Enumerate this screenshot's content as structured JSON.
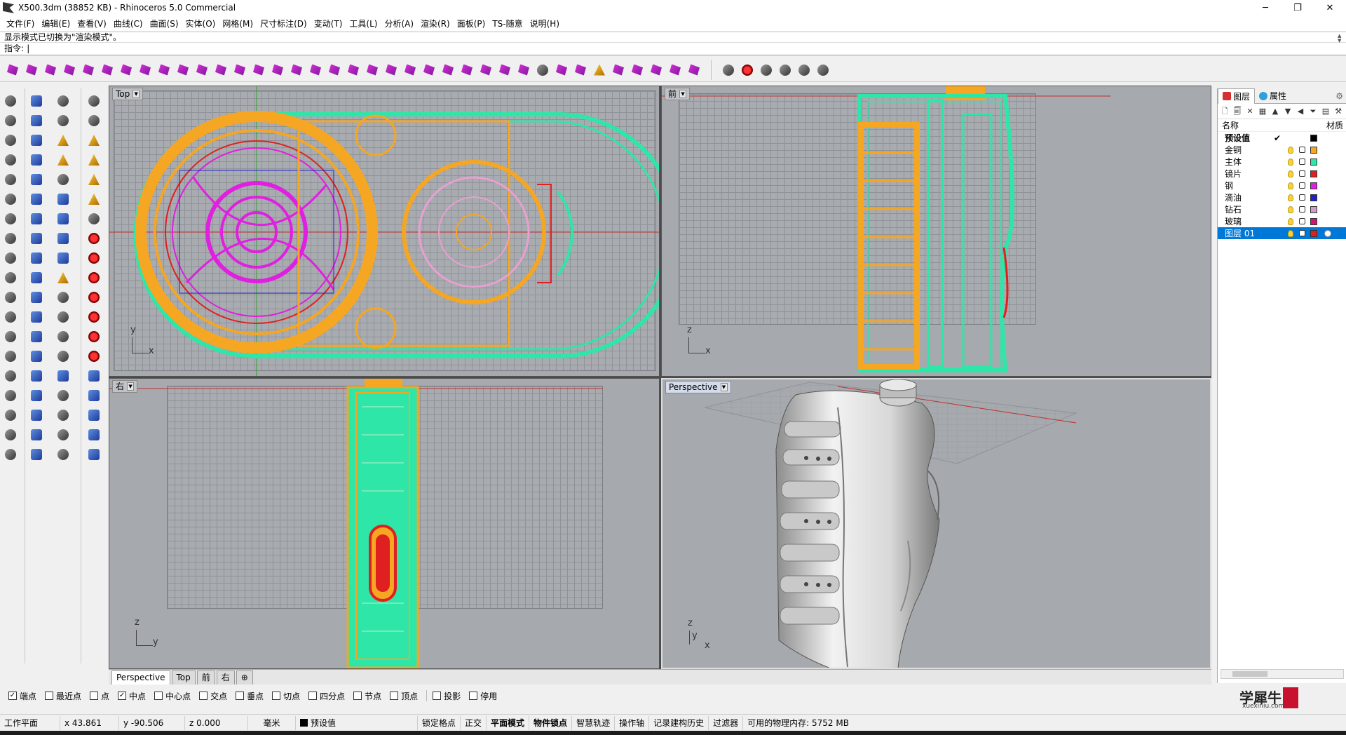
{
  "window": {
    "title": "X500.3dm (38852 KB) - Rhinoceros 5.0 Commercial",
    "minimize": "─",
    "maximize": "❐",
    "close": "✕"
  },
  "menu": [
    "文件(F)",
    "编辑(E)",
    "查看(V)",
    "曲线(C)",
    "曲面(S)",
    "实体(O)",
    "网格(M)",
    "尺寸标注(D)",
    "变动(T)",
    "工具(L)",
    "分析(A)",
    "渲染(R)",
    "面板(P)",
    "TS-随意",
    "说明(H)"
  ],
  "command": {
    "history": "显示模式已切换为\"渲染模式\"。",
    "prompt_label": "指令:",
    "prompt_value": ""
  },
  "viewports": {
    "top": {
      "name": "Top",
      "axis_a": "y",
      "axis_b": "x"
    },
    "front": {
      "name": "前",
      "axis_a": "z",
      "axis_b": "x"
    },
    "right": {
      "name": "右",
      "axis_a": "z",
      "axis_b": "y"
    },
    "perspective": {
      "name": "Perspective",
      "axis_a": "z",
      "axis_b": "y",
      "axis_c": "x"
    }
  },
  "viewport_tabs": [
    "Perspective",
    "Top",
    "前",
    "右",
    "⊕"
  ],
  "layers_panel": {
    "tab_layers": "图层",
    "tab_properties": "属性",
    "col_name": "名称",
    "col_material": "材质",
    "layers": [
      {
        "name": "预设值",
        "color": "#000000",
        "current": true
      },
      {
        "name": "金铜",
        "color": "#f5a623"
      },
      {
        "name": "主体",
        "color": "#2ee6a8"
      },
      {
        "name": "镜片",
        "color": "#e02020"
      },
      {
        "name": "钢",
        "color": "#e020e0"
      },
      {
        "name": "滴油",
        "color": "#2020d0"
      },
      {
        "name": "钻石",
        "color": "#c8a0c8"
      },
      {
        "name": "玻璃",
        "color": "#d01870"
      },
      {
        "name": "图层 01",
        "color": "#e02020",
        "selected": true
      }
    ]
  },
  "osnap": [
    {
      "label": "端点",
      "checked": true
    },
    {
      "label": "最近点",
      "checked": false
    },
    {
      "label": "点",
      "checked": false
    },
    {
      "label": "中点",
      "checked": true
    },
    {
      "label": "中心点",
      "checked": false
    },
    {
      "label": "交点",
      "checked": false
    },
    {
      "label": "垂点",
      "checked": false
    },
    {
      "label": "切点",
      "checked": false
    },
    {
      "label": "四分点",
      "checked": false
    },
    {
      "label": "节点",
      "checked": false
    },
    {
      "label": "顶点",
      "checked": false
    },
    {
      "label": "投影",
      "checked": false
    },
    {
      "label": "停用",
      "checked": false
    }
  ],
  "watermark": {
    "text": "学犀牛",
    "sub": "xuexiniu.com"
  },
  "status": {
    "cplane": "工作平面",
    "x": "x 43.861",
    "y": "y -90.506",
    "z": "z 0.000",
    "units": "毫米",
    "layer": "预设值",
    "grid_snap": "锁定格点",
    "ortho": "正交",
    "planar": "平面模式",
    "osnap": "物件锁点",
    "smart_track": "智慧轨迹",
    "gumball": "操作轴",
    "history": "记录建构历史",
    "filter": "过滤器",
    "memory": "可用的物理内存: 5752 MB"
  },
  "colors": {
    "orange": "#f5a623",
    "green": "#2ee6a8",
    "magenta": "#e020e0",
    "red": "#e02020",
    "blue": "#2020d0",
    "viewport_bg": "#a6a9ad",
    "selection": "#0078d7"
  }
}
